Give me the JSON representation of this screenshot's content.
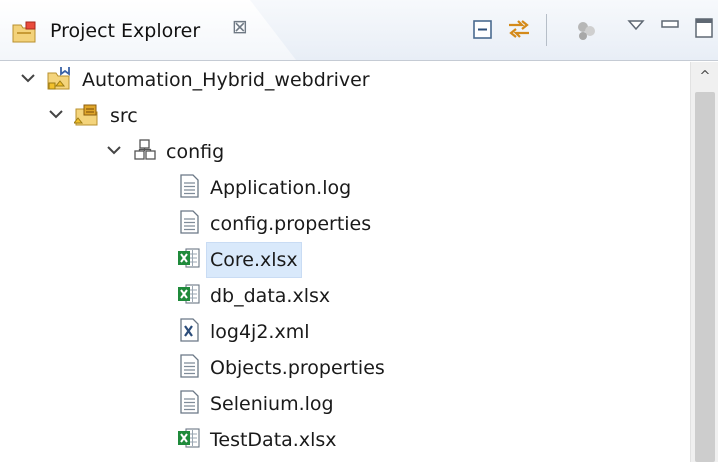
{
  "view": {
    "title": "Project Explorer",
    "close_glyph": "⊠",
    "icon": "project-explorer-icon"
  },
  "toolbar": [
    {
      "name": "collapse-all-icon"
    },
    {
      "name": "link-with-editor-icon"
    },
    {
      "name": "focus-on-active-task-icon"
    },
    {
      "name": "view-menu-icon"
    },
    {
      "name": "minimize-icon"
    },
    {
      "name": "maximize-icon"
    }
  ],
  "tree": [
    {
      "label": "Automation_Hybrid_webdriver",
      "icon": "java-project-icon",
      "level": 0,
      "expanded": true
    },
    {
      "label": "src",
      "icon": "source-folder-icon",
      "level": 1,
      "expanded": true
    },
    {
      "label": "config",
      "icon": "package-icon",
      "level": 2,
      "expanded": true
    },
    {
      "label": "Application.log",
      "icon": "text-file-icon",
      "level": 3
    },
    {
      "label": "config.properties",
      "icon": "text-file-icon",
      "level": 3
    },
    {
      "label": "Core.xlsx",
      "icon": "excel-file-icon",
      "level": 3,
      "selected": true
    },
    {
      "label": "db_data.xlsx",
      "icon": "excel-file-icon",
      "level": 3
    },
    {
      "label": "log4j2.xml",
      "icon": "xml-file-icon",
      "level": 3
    },
    {
      "label": "Objects.properties",
      "icon": "text-file-icon",
      "level": 3
    },
    {
      "label": "Selenium.log",
      "icon": "text-file-icon",
      "level": 3
    },
    {
      "label": "TestData.xlsx",
      "icon": "excel-file-icon",
      "level": 3
    }
  ],
  "scrollbar": {
    "up_glyph": "^"
  },
  "colors": {
    "selection": "#d9e9fb",
    "accent": "#1f8a3b"
  }
}
